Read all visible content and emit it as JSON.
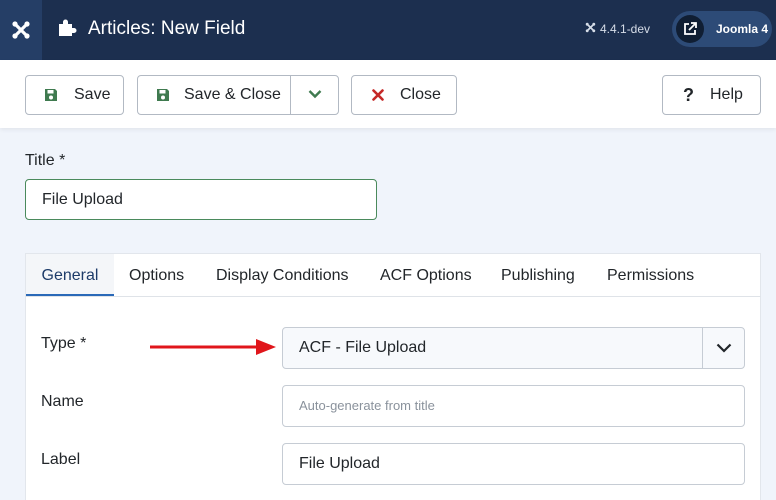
{
  "header": {
    "title": "Articles: New Field",
    "version": "4.4.1-dev",
    "site_label": "Joomla 4"
  },
  "toolbar": {
    "save_label": "Save",
    "save_close_label": "Save & Close",
    "close_label": "Close",
    "help_label": "Help"
  },
  "form": {
    "title_label": "Title *",
    "title_value": "File Upload"
  },
  "tabs": [
    {
      "label": "General",
      "active": true
    },
    {
      "label": "Options",
      "active": false
    },
    {
      "label": "Display Conditions",
      "active": false
    },
    {
      "label": "ACF Options",
      "active": false
    },
    {
      "label": "Publishing",
      "active": false
    },
    {
      "label": "Permissions",
      "active": false
    }
  ],
  "general": {
    "type_label": "Type *",
    "type_value": "ACF - File Upload",
    "name_label": "Name",
    "name_placeholder": "Auto-generate from title",
    "name_value": "",
    "label_label": "Label",
    "label_value": "File Upload"
  },
  "colors": {
    "header_bg": "#1c2f4f",
    "save_icon": "#3f7a4f",
    "close_icon": "#c52827",
    "arrow": "#e0161b",
    "active_tab": "#2a69b8"
  }
}
